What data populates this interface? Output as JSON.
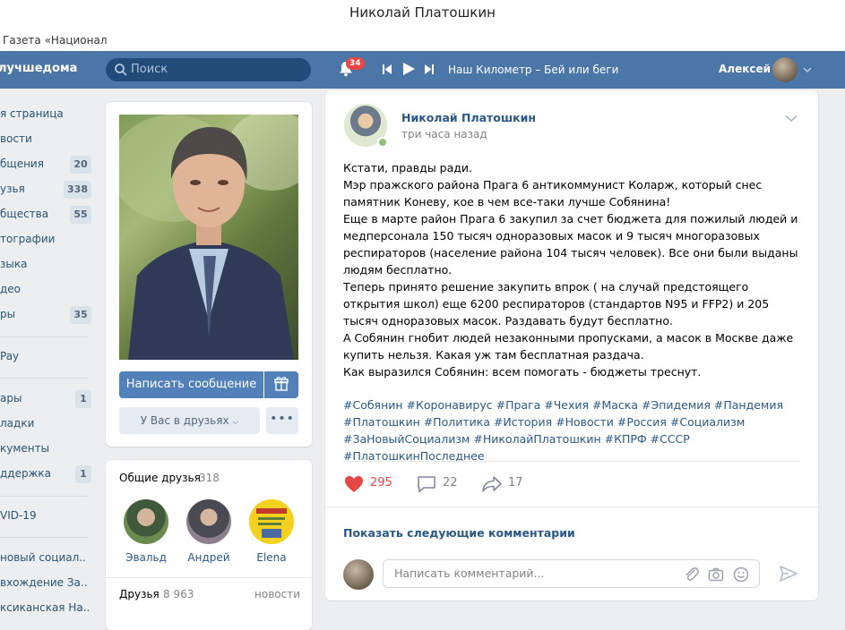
{
  "window": {
    "title": "Николай Платошкин",
    "tab": "Газета «Национал"
  },
  "topbar": {
    "brand": "лучшедома",
    "search_placeholder": "Поиск",
    "notifications": "34",
    "track": "Наш Километр – Бей или беги",
    "user": "Алексей"
  },
  "left_nav": [
    {
      "label": "я страница",
      "count": ""
    },
    {
      "label": "вости",
      "count": ""
    },
    {
      "label": "бщения",
      "count": "20"
    },
    {
      "label": "узья",
      "count": "338"
    },
    {
      "label": "бщества",
      "count": "55"
    },
    {
      "label": "тографии",
      "count": ""
    },
    {
      "label": "зыка",
      "count": ""
    },
    {
      "label": "део",
      "count": ""
    },
    {
      "label": "ры",
      "count": "35"
    },
    {
      "label": "Pay",
      "count": ""
    },
    {
      "label": "ары",
      "count": "1"
    },
    {
      "label": "ладки",
      "count": ""
    },
    {
      "label": "кументы",
      "count": ""
    },
    {
      "label": "ддержка",
      "count": "1"
    },
    {
      "label": "VID-19",
      "count": ""
    },
    {
      "label": "новый социал..",
      "count": ""
    },
    {
      "label": "вхождение За..",
      "count": ""
    },
    {
      "label": "ксиканская На..",
      "count": ""
    }
  ],
  "profile": {
    "message_button": "Написать сообщение",
    "friends_button": "У Вас в друзьях",
    "more_button": "•••"
  },
  "mutual": {
    "title": "Общие друзья",
    "count": "318",
    "friends": [
      {
        "name": "Эвальд"
      },
      {
        "name": "Андрей"
      },
      {
        "name": "Elena"
      }
    ],
    "friends_title": "Друзья",
    "friends_count": "8 963",
    "news_link": "новости"
  },
  "post": {
    "author": "Николай Платошкин",
    "time": "три часа назад",
    "text": [
      "Кстати, правды ради.",
      "Мэр пражского района Прага 6 антикоммунист Коларж, который снес памятник Коневу, кое в чем все-таки лучше Собянина!",
      "Еще в марте район Прага 6 закупил за счет бюджета для пожилый людей и медперсонала 150 тысяч одноразовых масок и 9 тысяч многоразовых респираторов (население района 104 тысяч человек). Все они были выданы людям бесплатно.",
      "Теперь принято решение закупить впрок ( на случай предстоящего открытия школ) еще 6200 респираторов (стандартов N95 и FFP2) и 205 тысяч одноразовых масок. Раздавать будут бесплатно.",
      "А Собянин гнобит людей незаконными пропусками, а масок в Москве даже купить нельзя. Какая уж там бесплатная раздача.",
      "Как выразился Собянин: всем помогать - бюджеты треснут."
    ],
    "tags": [
      "#Собянин #Коронавирус #Прага #Чехия #Маска #Эпидемия #Пандемия",
      "#Платошкин #Политика #История #Новости #Россия #Социализм",
      "#ЗаНовыйСоциализм #НиколайПлатошкин #КПРФ #СССР #ПлатошкинПоследнее"
    ],
    "likes": "295",
    "comments": "22",
    "shares": "17",
    "show_more": "Показать следующие комментарии",
    "comment_placeholder": "Написать комментарий..."
  },
  "colors": {
    "header": "#4a76a8",
    "button": "#5181b8",
    "link": "#2a5885",
    "like": "#e64646"
  }
}
